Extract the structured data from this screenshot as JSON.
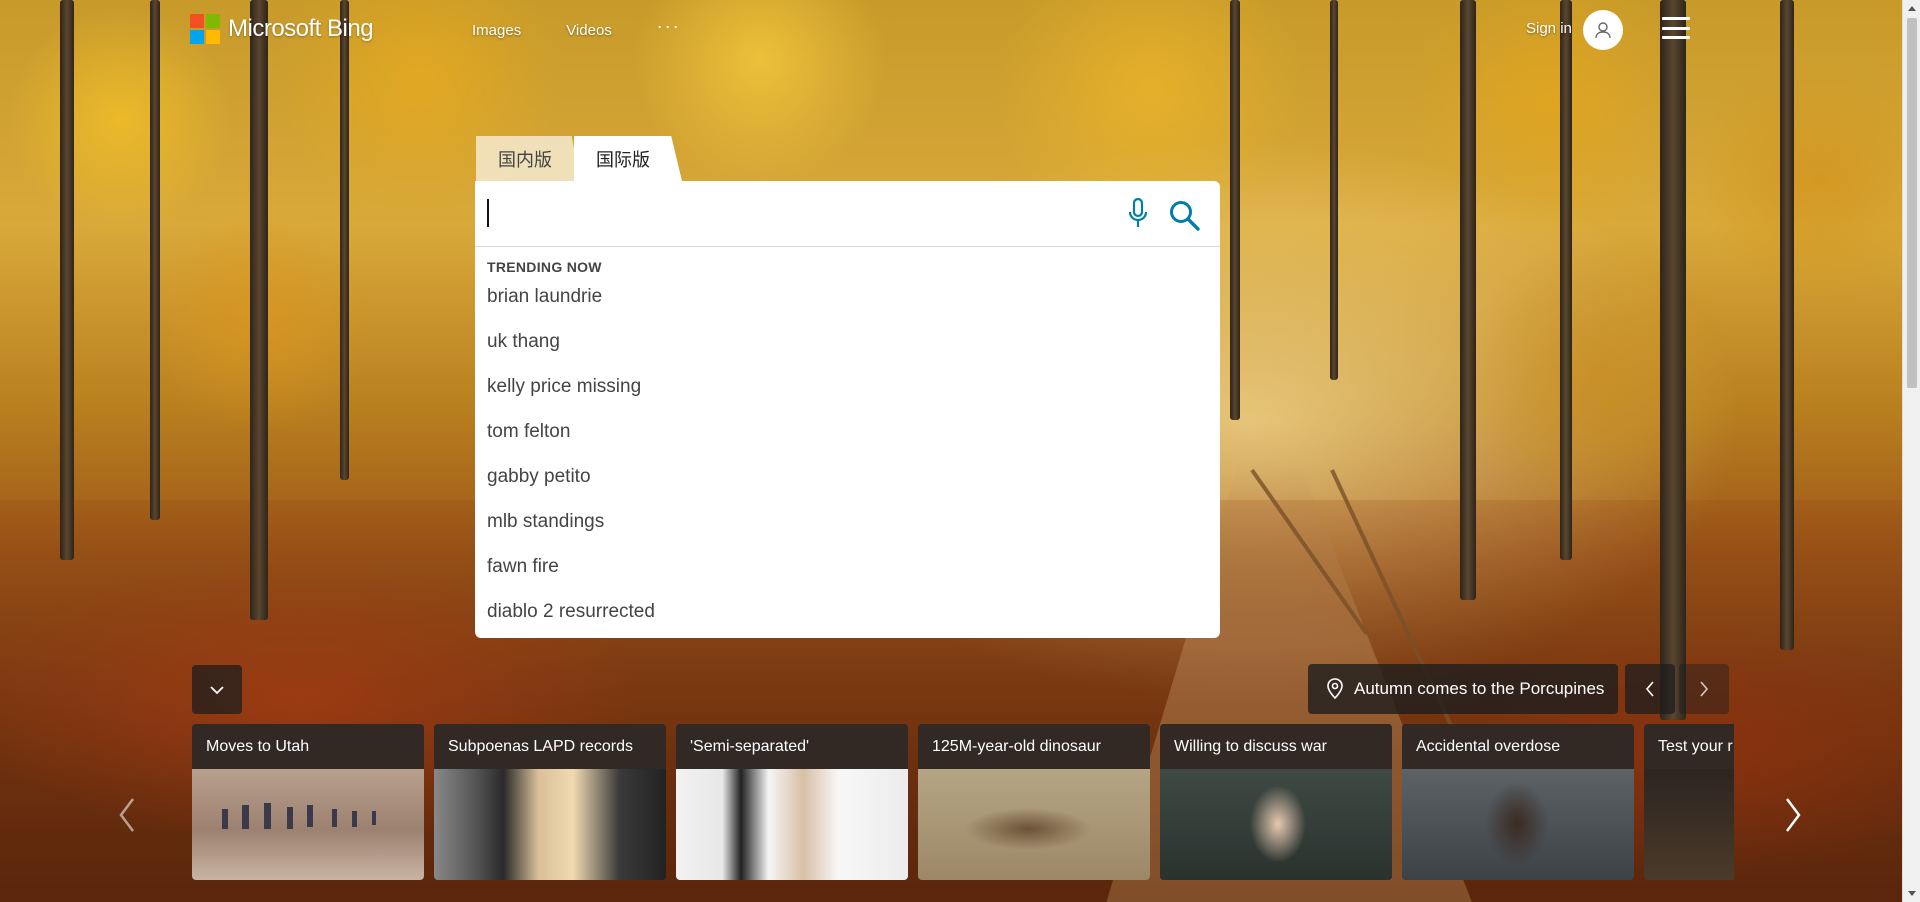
{
  "header": {
    "brand": "Microsoft Bing",
    "nav": [
      "Images",
      "Videos"
    ],
    "more": "···",
    "sign_in": "Sign in"
  },
  "search": {
    "tabs": [
      "国内版",
      "国际版"
    ],
    "active_tab": "国际版",
    "value": "",
    "mic_icon": "microphone-icon",
    "search_icon": "magnifier-icon",
    "accent_color": "#007daa"
  },
  "trending": {
    "title": "TRENDING NOW",
    "items": [
      "brian laundrie",
      "uk thang",
      "kelly price missing",
      "tom felton",
      "gabby petito",
      "mlb standings",
      "fawn fire",
      "diablo 2 resurrected"
    ]
  },
  "image_of_day": {
    "location_label": "Autumn comes to the Porcupines"
  },
  "news_cards": [
    {
      "caption": "Moves to Utah"
    },
    {
      "caption": "Subpoenas LAPD records"
    },
    {
      "caption": "'Semi-separated'"
    },
    {
      "caption": "125M-year-old dinosaur"
    },
    {
      "caption": "Willing to discuss war"
    },
    {
      "caption": "Accidental overdose"
    },
    {
      "caption": "Test your r"
    }
  ]
}
